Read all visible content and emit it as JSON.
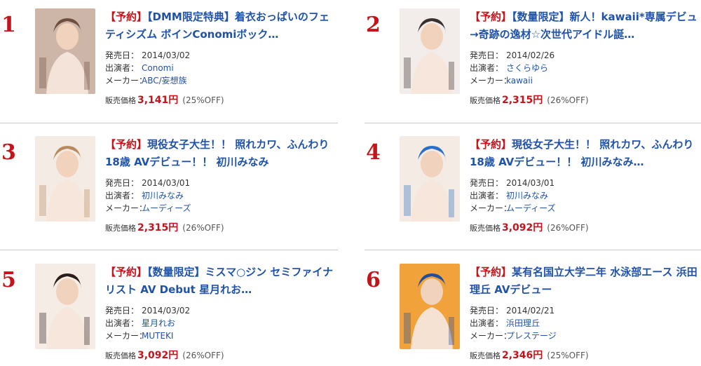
{
  "items": [
    {
      "rank": "1",
      "tag": "【予約】",
      "title": "【DMM限定特典】着衣おっぱいのフェティシズム ボインConomiボック…",
      "date_label": "発売日：",
      "date": "2014/03/02",
      "performer_label": "出演者：",
      "performer": "Conomi",
      "maker_label": "メーカー：",
      "maker": "ABC/妄想族",
      "price_label": "販売価格",
      "price": "3,141円",
      "discount": "(25%OFF)",
      "cover_color": "#cdb6a8",
      "cover_accent": "#6e4e3e"
    },
    {
      "rank": "2",
      "tag": "【予約】",
      "title": "【数量限定】新人！kawaii*専属デビュ→奇跡の逸材☆次世代アイドル誕…",
      "date_label": "発売日：",
      "date": "2014/02/26",
      "performer_label": "出演者：",
      "performer": "さくらゆら",
      "maker_label": "メーカー：",
      "maker": "kawaii",
      "price_label": "販売価格",
      "price": "2,315円",
      "discount": "(26%OFF)",
      "cover_color": "#f2ecea",
      "cover_accent": "#3a2e2e"
    },
    {
      "rank": "3",
      "tag": "【予約】",
      "title": "現役女子大生！！ 照れカワ、ふんわり18歳 AVデビュー！！ 初川みなみ",
      "date_label": "発売日：",
      "date": "2014/03/01",
      "performer_label": "出演者：",
      "performer": "初川みなみ",
      "maker_label": "メーカー：",
      "maker": "ムーディーズ",
      "price_label": "販売価格",
      "price": "2,315円",
      "discount": "(26%OFF)",
      "cover_color": "#f3ebe4",
      "cover_accent": "#b98a5e"
    },
    {
      "rank": "4",
      "tag": "【予約】",
      "title": "現役女子大生！！ 照れカワ、ふんわり18歳 AVデビュー！！ 初川みなみ…",
      "date_label": "発売日：",
      "date": "2014/03/01",
      "performer_label": "出演者：",
      "performer": "初川みなみ",
      "maker_label": "メーカー：",
      "maker": "ムーディーズ",
      "price_label": "販売価格",
      "price": "3,092円",
      "discount": "(26%OFF)",
      "cover_color": "#f3ebe4",
      "cover_accent": "#2a6fc9"
    },
    {
      "rank": "5",
      "tag": "【予約】",
      "title": "【数量限定】ミスマ○ジン セミファイナリスト AV Debut 星月れお…",
      "date_label": "発売日：",
      "date": "2014/03/02",
      "performer_label": "出演者：",
      "performer": "星月れお",
      "maker_label": "メーカー：",
      "maker": "MUTEKI",
      "price_label": "販売価格",
      "price": "3,092円",
      "discount": "(26%OFF)",
      "cover_color": "#f6ece6",
      "cover_accent": "#2b1e1a"
    },
    {
      "rank": "6",
      "tag": "【予約】",
      "title": "某有名国立大学二年 水泳部エース 浜田理丘 AVデビュー",
      "date_label": "発売日：",
      "date": "2014/02/21",
      "performer_label": "出演者：",
      "performer": "浜田理丘",
      "maker_label": "メーカー：",
      "maker": "プレステージ",
      "price_label": "販売価格",
      "price": "2,346円",
      "discount": "(25%OFF)",
      "cover_color": "#f2a23a",
      "cover_accent": "#1f4ea0"
    }
  ]
}
